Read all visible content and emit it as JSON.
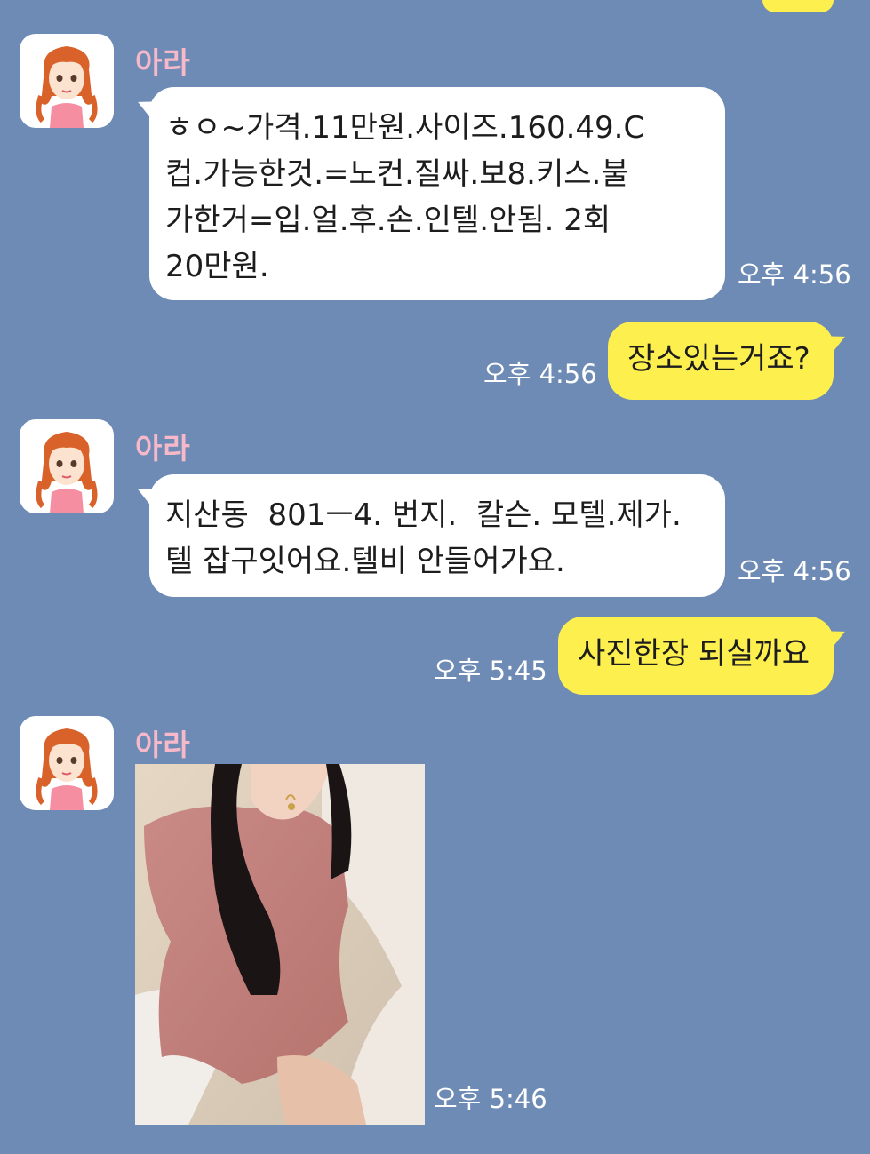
{
  "messages": [
    {
      "sender": "아라",
      "text": "ㅎㅇ~가격.11만원.사이즈.160.49.C\n컵.가능한것.=노컨.질싸.보8.키스.불\n가한거=입.얼.후.손.인텔.안됨. 2회\n20만원.",
      "time": "오후 4:56"
    },
    {
      "text": "장소있는거죠?",
      "time": "오후 4:56"
    },
    {
      "sender": "아라",
      "text": "지산동  801ㅡ4. 번지.  칼슨. 모텔.제가.\n텔 잡구잇어요.텔비 안들어가요.",
      "time": "오후 4:56"
    },
    {
      "text": "사진한장 되실까요",
      "time": "오후 5:45"
    },
    {
      "sender": "아라",
      "time": "오후 5:46"
    }
  ],
  "colors": {
    "background": "#6e8bb5",
    "incoming_bubble": "#ffffff",
    "outgoing_bubble": "#fdf04e",
    "sender_name": "#f7b9c9"
  }
}
